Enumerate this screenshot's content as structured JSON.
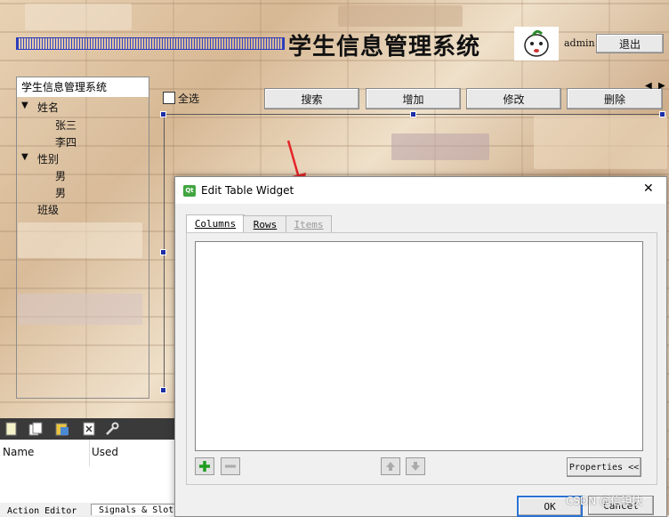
{
  "app": {
    "title": "学生信息管理系统",
    "user": "admin",
    "logout_label": "退出"
  },
  "tree": {
    "header": "学生信息管理系统",
    "nodes": [
      {
        "label": "姓名",
        "expander": "▼"
      },
      {
        "label": "张三"
      },
      {
        "label": "李四"
      },
      {
        "label": "性别",
        "expander": "▼"
      },
      {
        "label": "男"
      },
      {
        "label": "男"
      },
      {
        "label": "班级"
      }
    ]
  },
  "toolbar": {
    "select_all_label": "全选",
    "search_label": "搜索",
    "add_label": "增加",
    "edit_label": "修改",
    "delete_label": "删除",
    "scroll_left": "◀",
    "scroll_right": "▶"
  },
  "designer": {
    "props_columns": [
      "Name",
      "Used"
    ],
    "bottom_tabs": [
      "Action Editor",
      "Signals & Slots"
    ]
  },
  "dialog": {
    "title": "Edit Table Widget",
    "app_icon": "qt-designer-icon",
    "close_glyph": "✕",
    "tabs": [
      {
        "label": "Columns",
        "active": true
      },
      {
        "label": "Rows",
        "active": false
      },
      {
        "label": "Items",
        "active": false
      }
    ],
    "properties_label": "Properties <<",
    "ok_label": "OK",
    "cancel_label": "Cancel"
  },
  "watermark": "CSDN @信钽块",
  "colors": {
    "accent_blue": "#1d2ea6",
    "plus_green": "#1f9c1f",
    "arrow_red": "#e5252a"
  }
}
